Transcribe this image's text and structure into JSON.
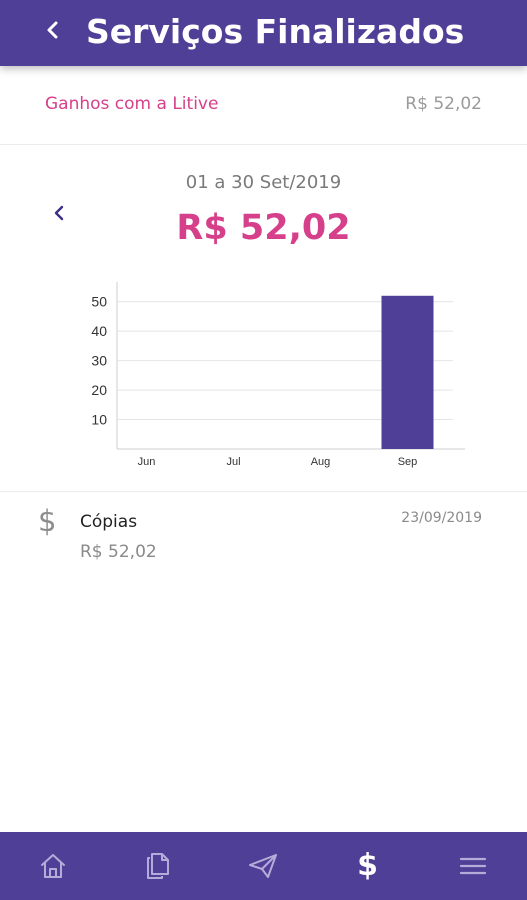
{
  "header": {
    "title": "Serviços Finalizados",
    "back_icon": "chevron-left-icon"
  },
  "summary": {
    "label": "Ganhos com a Litive",
    "value": "R$ 52,02"
  },
  "period": {
    "label": "01 a 30 Set/2019",
    "total": "R$ 52,02",
    "prev_icon": "chevron-left-icon"
  },
  "colors": {
    "primary": "#4f3f97",
    "accent": "#d6408b",
    "bar": "#4f3f97"
  },
  "chart_data": {
    "type": "bar",
    "categories": [
      "Jun",
      "Jul",
      "Aug",
      "Sep"
    ],
    "values": [
      0,
      0,
      0,
      52.02
    ],
    "yticks": [
      10,
      20,
      30,
      40,
      50
    ],
    "ylim": [
      0,
      55
    ],
    "grid": true,
    "title": "",
    "xlabel": "",
    "ylabel": ""
  },
  "transactions": [
    {
      "icon": "dollar-icon",
      "name": "Cópias",
      "date": "23/09/2019",
      "amount": "R$ 52,02"
    }
  ],
  "bottom_nav": [
    {
      "icon": "home-icon",
      "active": false
    },
    {
      "icon": "documents-icon",
      "active": false
    },
    {
      "icon": "send-icon",
      "active": false
    },
    {
      "icon": "dollar-icon",
      "symbol": "$",
      "active": true
    },
    {
      "icon": "menu-icon",
      "active": false
    }
  ]
}
